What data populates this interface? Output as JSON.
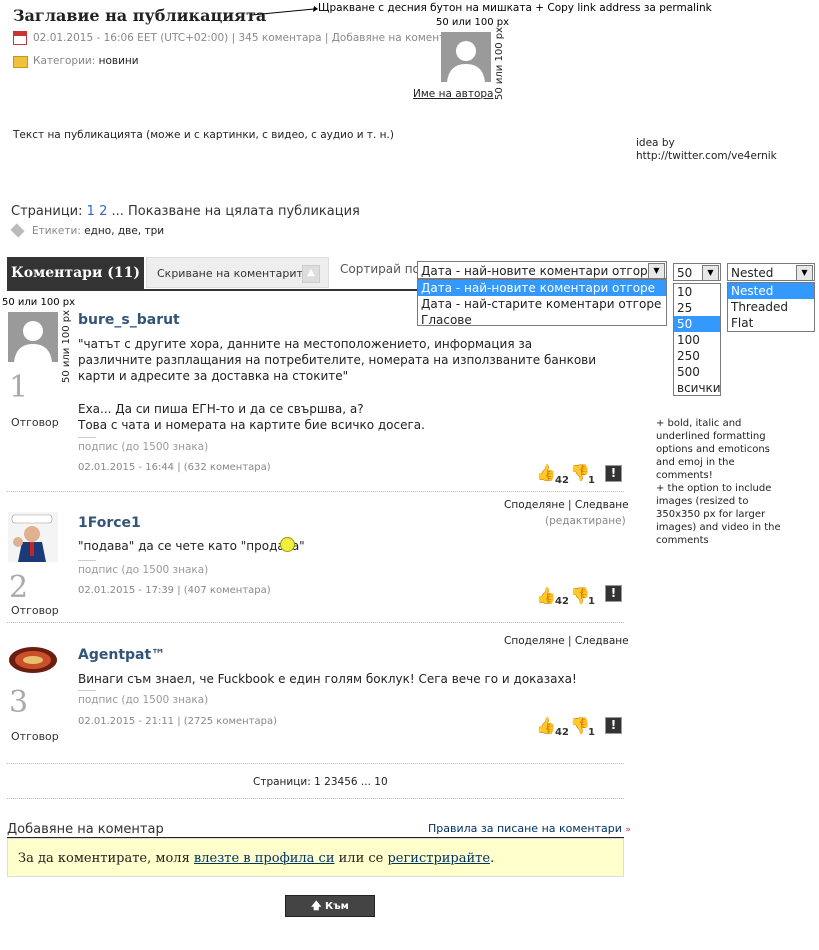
{
  "post": {
    "title": "Заглавие на публикацията",
    "permalink_note": "Щракване с десния бутон на мишката + Copy link address за permalink",
    "meta_date": "02.01.2015 - 16:06 EET (UTC+02:00) | 345 коментара | Добавяне на коментар",
    "categories_label": "Категории:",
    "categories_value": "новини",
    "author_size_top": "50 или 100 px",
    "author_size_side": "50 или 100 px",
    "author_name": "Име на автора",
    "body_text": "Текст на публикацията (може и с картинки, с видео, с аудио и т. н.)",
    "idea_line1": "idea by",
    "idea_line2": "http://twitter.com/ve4ernik",
    "pages_label": "Страници:",
    "pages": [
      "1",
      "2"
    ],
    "pages_full": "... Показване на цялата публикация",
    "tags_label": "Етикети:",
    "tags_value": "едно, две, три"
  },
  "comments_bar": {
    "tab_label": "Коментари (11)",
    "hide_label": "Скриване на коментарите",
    "sort_label": "Сортирай по:",
    "sort_selected": "Дата - най-новите коментари отгоре",
    "sort_options": [
      "Дата - най-новите коментари отгоре",
      "Дата - най-старите коментари отгоре",
      "Гласове"
    ],
    "count_selected": "50",
    "count_options": [
      "10",
      "25",
      "50",
      "100",
      "250",
      "500",
      "всички"
    ],
    "mode_selected": "Nested",
    "mode_options": [
      "Nested",
      "Threaded",
      "Flat"
    ]
  },
  "avatar_size_note_top": "50 или 100 px",
  "avatar_size_note_side": "50 или 100 px",
  "side_note": "+ bold, italic and underlined formatting options and emoticons and emoj in the comments!\n+ the option to include images (resized to 350x350 px for larger images) and video in the comments",
  "comments": [
    {
      "num": "1",
      "reply": "Отговор",
      "user": "bure_s_barut",
      "quote": "\"чатът с другите хора, данните на местоположението, информация за различните разплащания на потребителите, номерата на използваните банкови карти и адресите за доставка на стоките\"",
      "text1": "Еха... Да си пиша ЕГН-то и да се свършва, а?",
      "text2": "Това с чата и номерата на картите бие всичко досега.",
      "sig": "подпис (до 1500 знака)",
      "meta": "02.01.2015 - 16:44 | (632 коментара)",
      "likes": "42",
      "dislikes": "1",
      "share": "",
      "edited": ""
    },
    {
      "num": "2",
      "reply": "Отговор",
      "user": "1Force1",
      "text1": "\"подава\" да се чете като \"продава\"",
      "sig": "подпис (до 1500 знака)",
      "meta": "02.01.2015 - 17:39 | (407 коментара)",
      "likes": "42",
      "dislikes": "1",
      "share": "Споделяне | Следване",
      "edited": "(редактиране)"
    },
    {
      "num": "3",
      "reply": "Отговор",
      "user": "Agentpat™",
      "text1": "Винаги съм знаел, че Fuckbook е един голям боклук! Сега вече го и доказаха!",
      "sig": "подпис (до 1500 знака)",
      "meta": "02.01.2015 - 21:11 | (2725 коментара)",
      "likes": "42",
      "dislikes": "1",
      "share": "Споделяне | Следване",
      "edited": ""
    }
  ],
  "pager": {
    "label": "Страници:",
    "pages": [
      "1",
      "2",
      "3",
      "4",
      "5",
      "6",
      "...",
      "10"
    ]
  },
  "add_comment": {
    "title": "Добавяне на коментар",
    "rules_link": "Правила за писане на коментари",
    "login_prefix": "За да коментирате, моля",
    "login_link": "влезте в профила си",
    "or_text": "или се",
    "register_link": "регистрирайте",
    "end": "."
  },
  "to_top": "Към началото"
}
